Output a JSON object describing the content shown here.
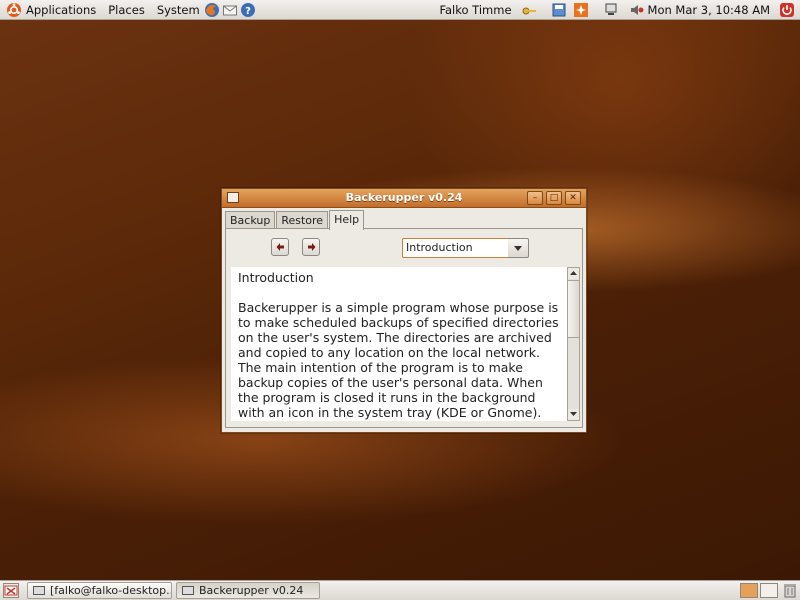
{
  "top_panel": {
    "menus": [
      "Applications",
      "Places",
      "System"
    ],
    "user": "Falko Timme",
    "clock": "Mon Mar  3, 10:48 AM"
  },
  "window": {
    "title": "Backerupper v0.24",
    "tabs": [
      "Backup",
      "Restore",
      "Help"
    ],
    "active_tab": "Help",
    "topic_select": {
      "value": "Introduction"
    },
    "help": {
      "heading": "Introduction",
      "body": "Backerupper is a simple program whose purpose is to make scheduled backups of specified directories on the user's system. The directories are archived and copied to any location on the local network. The main intention of the program is to make backup copies of the user's personal data. When the program is closed it runs in the background with an icon in the system tray (KDE or Gnome)."
    }
  },
  "taskbar": {
    "items": [
      "[falko@falko-desktop...",
      "Backerupper v0.24"
    ]
  },
  "colors": {
    "titlebar": "#d98a3f",
    "desktop": "#4a1f06",
    "accent": "#c6813b"
  }
}
